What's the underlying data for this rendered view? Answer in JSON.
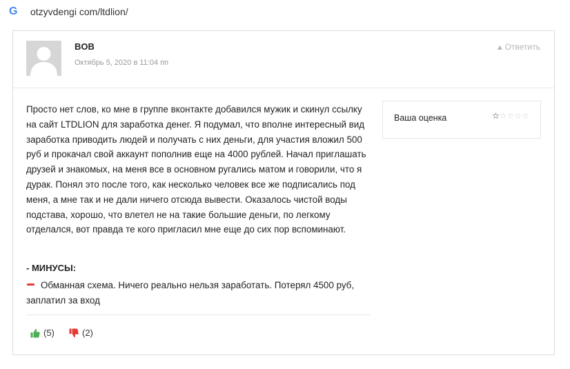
{
  "browser": {
    "logo": "G",
    "url": "otzyvdengi com/ltdlion/"
  },
  "comment": {
    "author": "BOB",
    "date": "Октябрь 5, 2020 в 11:04 пп",
    "reply_label": "Ответить",
    "text": "Просто нет слов, ко мне в группе вконтакте добавился мужик и скинул ссылку на сайт LTDLION для заработка денег. Я подумал, что вполне интересный вид заработка приводить людей и получать с них деньги, для участия вложил 500 руб и прокачал свой аккаунт пополнив еще на 4000 рублей. Начал приглашать друзей и знакомых, на меня все в основном ругались матом и говорили, что я дурак. Понял это после того, как несколько человек все же подписались под меня, а мне так и не дали ничего отсюда вывести. Оказалось чистой воды подстава, хорошо, что влетел не на такие большие деньги, по легкому отделался, вот правда те кого пригласил мне еще до сих пор вспоминают.",
    "minuses_title": "- МИНУСЫ:",
    "minuses_text": "Обманная схема. Ничего реально нельзя заработать. Потерял 4500 руб, заплатил за вход",
    "votes_up": "(5)",
    "votes_down": "(2)"
  },
  "rating": {
    "label": "Ваша оценка",
    "value": 0.5,
    "max": 5,
    "star_color": "#333333"
  },
  "icons": {
    "thumbs_up_color": "#4caf50",
    "thumbs_down_color": "#e53935",
    "minus_color": "#e53935"
  }
}
